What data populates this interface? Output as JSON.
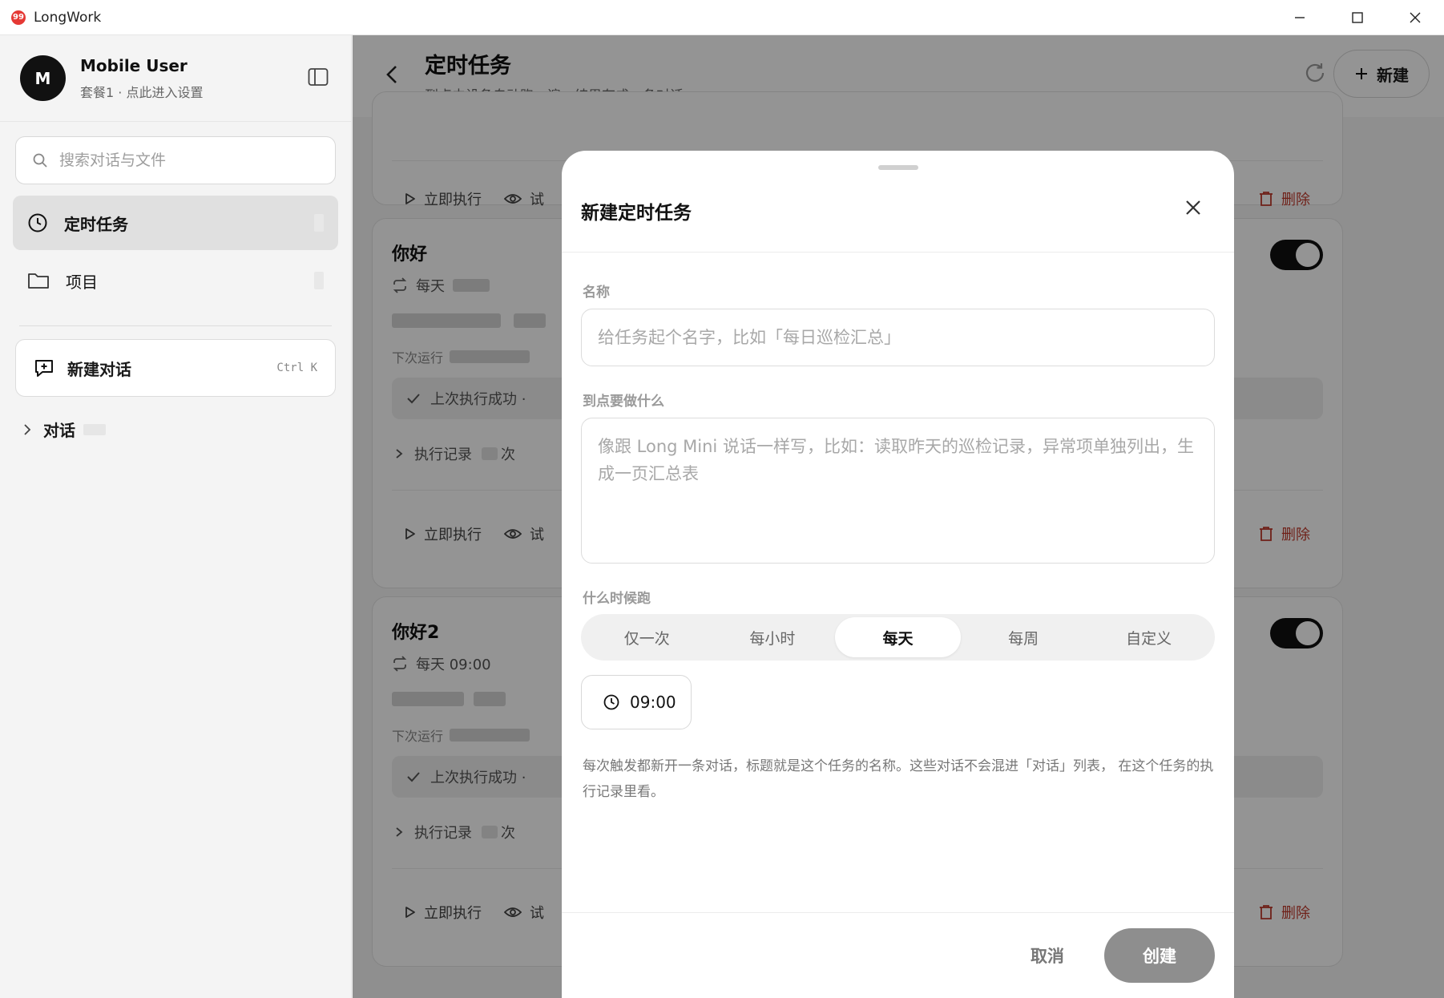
{
  "window": {
    "title": "LongWork",
    "logo_text": "99"
  },
  "sidebar": {
    "user": {
      "avatar_initial": "M",
      "name": "Mobile User",
      "subtitle": "套餐1 · 点此进入设置"
    },
    "search": {
      "placeholder": "搜索对话与文件"
    },
    "nav": [
      {
        "label": "定时任务",
        "active": true
      },
      {
        "label": "项目",
        "active": false
      }
    ],
    "new_chat": {
      "label": "新建对话",
      "shortcut": "Ctrl K"
    },
    "conversations": {
      "label": "对话"
    }
  },
  "main": {
    "header": {
      "title": "定时任务",
      "subtitle": "到点由设备自动跑一遍，结果存成一条对话",
      "new_label": "新建"
    },
    "tasks": [
      {
        "title": "你好",
        "schedule": "每天",
        "next_prefix": "下次运行",
        "status": "上次执行成功 ·",
        "history_prefix": "执行记录",
        "history_suffix": "次",
        "run_label": "立即执行",
        "preview_label": "试",
        "delete_label": "删除",
        "enabled": true
      },
      {
        "title": "你好2",
        "schedule": "每天 09:00",
        "next_prefix": "下次运行",
        "status": "上次执行成功 ·",
        "history_prefix": "执行记录",
        "history_suffix": "次",
        "run_label": "立即执行",
        "preview_label": "试",
        "delete_label": "删除",
        "enabled": true
      }
    ],
    "top_card": {
      "run_label": "立即执行",
      "preview_label": "试",
      "delete_label": "删除"
    }
  },
  "modal": {
    "title": "新建定时任务",
    "name_label": "名称",
    "name_placeholder": "给任务起个名字，比如「每日巡检汇总」",
    "prompt_label": "到点要做什么",
    "prompt_placeholder": "像跟 Long Mini 说话一样写，比如：读取昨天的巡检记录，异常项单独列出，生成一页汇总表",
    "when_label": "什么时候跑",
    "frequency_options": [
      "仅一次",
      "每小时",
      "每天",
      "每周",
      "自定义"
    ],
    "frequency_selected": "每天",
    "time": "09:00",
    "hint": "每次触发都新开一条对话，标题就是这个任务的名称。这些对话不会混进「对话」列表， 在这个任务的执行记录里看。",
    "cancel_label": "取消",
    "create_label": "创建"
  }
}
